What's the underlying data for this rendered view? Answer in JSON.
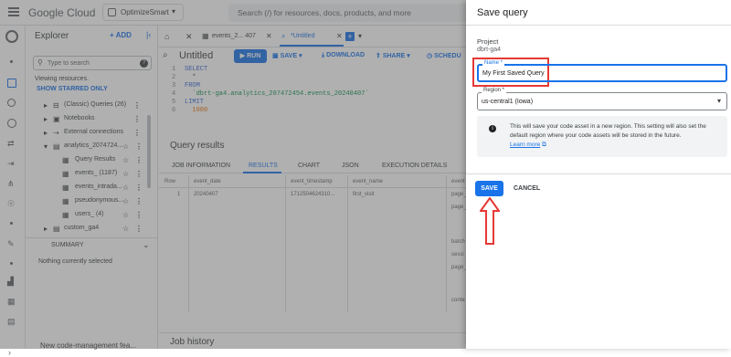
{
  "topbar": {
    "brand": "Google Cloud",
    "project": "OptimizeSmart",
    "search_placeholder": "Search (/) for resources, docs, products, and more"
  },
  "explorer": {
    "title": "Explorer",
    "add_label": "ADD",
    "search_placeholder": "Type to search",
    "viewing_text": "Viewing resources.",
    "show_starred": "SHOW STARRED ONLY",
    "items": [
      {
        "label": "(Classic) Queries (26)"
      },
      {
        "label": "Notebooks"
      },
      {
        "label": "External connections"
      },
      {
        "label": "analytics_2074724..."
      },
      {
        "label": "Query Results"
      },
      {
        "label": "events_ (1187)"
      },
      {
        "label": "events_intrada..."
      },
      {
        "label": "pseudonymous..."
      },
      {
        "label": "users_ (4)"
      },
      {
        "label": "custom_ga4"
      }
    ],
    "summary_label": "SUMMARY",
    "nothing_selected": "Nothing currently selected",
    "footer_text": "New code-management fea..."
  },
  "editor": {
    "tabs": [
      {
        "label": "events_2... 407"
      },
      {
        "label": "*Untitled"
      }
    ],
    "title": "Untitled",
    "run_label": "RUN",
    "save_label": "SAVE",
    "download_label": "DOWNLOAD",
    "share_label": "SHARE",
    "schedule_label": "SCHEDU",
    "code_lines": [
      {
        "num": "1",
        "text": "SELECT"
      },
      {
        "num": "2",
        "text": "  *"
      },
      {
        "num": "3",
        "text": "FROM"
      },
      {
        "num": "4",
        "text": "  `dbrt-ga4.analytics_207472454.events_20240407`"
      },
      {
        "num": "5",
        "text": "LIMIT"
      },
      {
        "num": "6",
        "text": "  1000"
      }
    ]
  },
  "results": {
    "title": "Query results",
    "tabs": [
      "JOB INFORMATION",
      "RESULTS",
      "CHART",
      "JSON",
      "EXECUTION DETAILS"
    ],
    "columns": [
      "Row",
      "event_date",
      "event_timestamp",
      "event_name",
      "event"
    ],
    "row": {
      "row": "1",
      "event_date": "20240407",
      "event_timestamp": "1712504624310...",
      "event_name": "first_visit",
      "event": "page_"
    },
    "extra_cells": [
      "page_",
      "batch",
      "sessi",
      "page_",
      "conte"
    ],
    "job_history": "Job history"
  },
  "dialog": {
    "title": "Save query",
    "project_label": "Project",
    "project_value": "dbrt-ga4",
    "name_label": "Name *",
    "name_value": "My First Saved Query",
    "region_label": "Region *",
    "region_value": "us-central1 (Iowa)",
    "info_text": "This will save your code asset in a new region. This setting will also set the default region where your code assets will be stored in the future.",
    "learn_more": "Learn more",
    "save_label": "SAVE",
    "cancel_label": "CANCEL"
  },
  "colors": {
    "accent": "#1a73e8",
    "highlight": "#e53935",
    "arrow": "#e53935"
  }
}
